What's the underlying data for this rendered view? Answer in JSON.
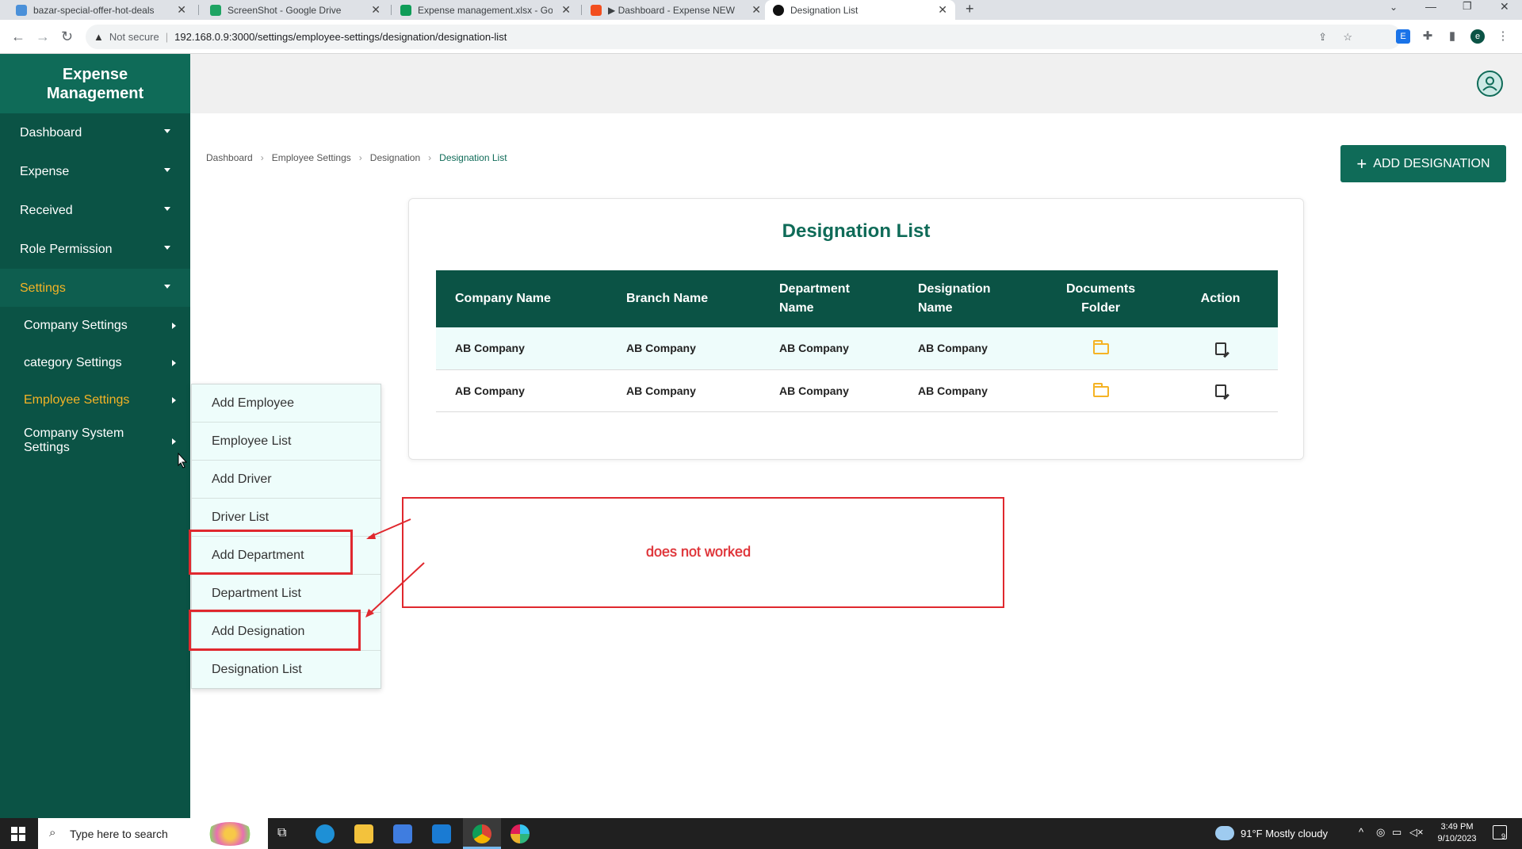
{
  "browser": {
    "tabs": [
      {
        "label": "bazar-special-offer-hot-deals",
        "icon_color": "#4a90d9"
      },
      {
        "label": "ScreenShot - Google Drive",
        "icon_color": "#1fa463"
      },
      {
        "label": "Expense management.xlsx - Goo",
        "icon_color": "#0f9d58"
      },
      {
        "label": "▶ Dashboard - Expense NEW",
        "icon_color": "#f24e1e"
      },
      {
        "label": "Designation List",
        "icon_color": "#111111"
      }
    ],
    "security_label": "Not secure",
    "url": "192.168.0.9:3000/settings/employee-settings/designation/designation-list",
    "profile_initial": "e"
  },
  "app": {
    "brand_line1": "Expense",
    "brand_line2": "Management",
    "accent_color": "#0f6b58",
    "highlight_color": "#f5b325"
  },
  "sidebar": {
    "items": [
      {
        "label": "Dashboard"
      },
      {
        "label": "Expense"
      },
      {
        "label": "Received"
      },
      {
        "label": "Role Permission"
      },
      {
        "label": "Settings"
      }
    ],
    "subitems": [
      {
        "label": "Company Settings"
      },
      {
        "label": "category Settings"
      },
      {
        "label": "Employee Settings"
      },
      {
        "label": "Company System",
        "label2": "Settings"
      }
    ]
  },
  "flyout": {
    "items": [
      {
        "label": "Add Employee"
      },
      {
        "label": "Employee List"
      },
      {
        "label": "Add Driver"
      },
      {
        "label": "Driver List"
      },
      {
        "label": "Add Department"
      },
      {
        "label": "Department List"
      },
      {
        "label": "Add Designation"
      },
      {
        "label": "Designation List"
      }
    ]
  },
  "breadcrumb": [
    "Dashboard",
    "Employee Settings",
    "Designation",
    "Designation List"
  ],
  "add_button_label": "ADD DESIGNATION",
  "card": {
    "title": "Designation List",
    "columns": [
      "Company Name",
      "Branch Name",
      "Department Name",
      "Designation Name",
      "Documents Folder",
      "Action"
    ],
    "rows": [
      [
        "AB Company",
        "AB Company",
        "AB Company",
        "AB Company"
      ],
      [
        "AB Company",
        "AB Company",
        "AB Company",
        "AB Company"
      ]
    ]
  },
  "annotation": {
    "note": "does not worked"
  },
  "taskbar": {
    "search_placeholder": "Type here to search",
    "weather": "91°F  Mostly cloudy",
    "time": "3:49 PM",
    "date": "9/10/2023",
    "notification_count": "9"
  }
}
